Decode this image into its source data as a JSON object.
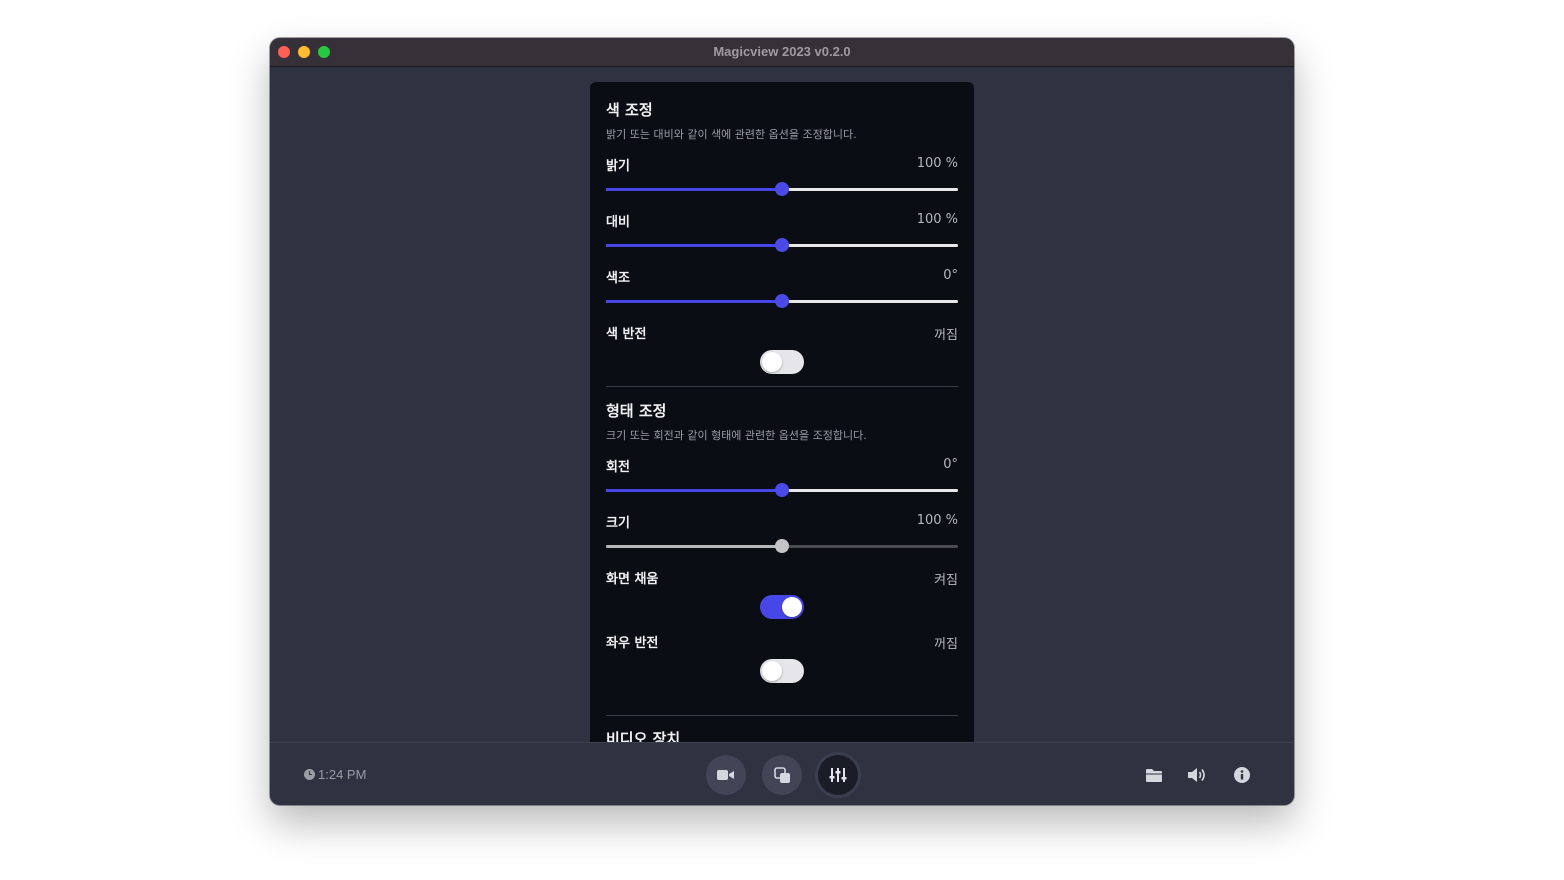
{
  "window": {
    "title": "Magicview 2023 v0.2.0"
  },
  "color_section": {
    "title": "색 조정",
    "description": "밝기 또는 대비와 같이 색에 관련한 옵션을 조정합니다.",
    "brightness": {
      "label": "밝기",
      "value": "100 %",
      "level": 0.5
    },
    "contrast": {
      "label": "대비",
      "value": "100 %",
      "level": 0.5
    },
    "hue": {
      "label": "색조",
      "value": "0°",
      "level": 0.5
    },
    "invert": {
      "label": "색 반전",
      "state": "꺼짐",
      "on": false
    }
  },
  "shape_section": {
    "title": "형태 조정",
    "description": "크기 또는 회전과 같이 형태에 관련한 옵션을 조정합니다.",
    "rotation": {
      "label": "회전",
      "value": "0°",
      "level": 0.5
    },
    "scale": {
      "label": "크기",
      "value": "100 %",
      "level": 0.5
    },
    "fill_screen": {
      "label": "화면 채움",
      "state": "켜짐",
      "on": true
    },
    "mirror": {
      "label": "좌우 반전",
      "state": "꺼짐",
      "on": false
    }
  },
  "video_section": {
    "title": "비디오 장치"
  },
  "bottom_bar": {
    "time": "1:24 PM",
    "center_buttons": [
      "video-icon",
      "copy-icon",
      "sliders-icon"
    ],
    "active_button": "sliders-icon",
    "right_buttons": [
      "folder-icon",
      "volume-icon",
      "info-icon"
    ]
  },
  "colors": {
    "accent": "#4747e8",
    "panel": "#0b0d14",
    "background": "#2e3241"
  }
}
